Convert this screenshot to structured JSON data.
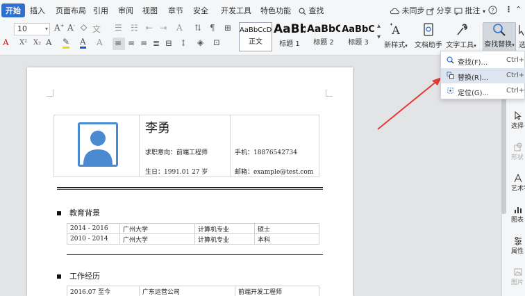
{
  "menu": {
    "tabs": [
      "开始",
      "插入",
      "页面布局",
      "引用",
      "审阅",
      "视图",
      "章节",
      "安全",
      "开发工具",
      "特色功能"
    ],
    "search_label": "查找",
    "sync": "未同步",
    "share": "分享",
    "comment": "批注"
  },
  "ribbon": {
    "font_size": "10",
    "styles": [
      {
        "preview": "AaBbCcDd",
        "name": "正文"
      },
      {
        "preview": "AaBb",
        "name": "标题 1"
      },
      {
        "preview": "AaBbC",
        "name": "标题 2"
      },
      {
        "preview": "AaBbC",
        "name": "标题 3"
      }
    ],
    "new_style": "新样式",
    "doc_helper": "文档助手",
    "text_tools": "文字工具",
    "find_replace": "查找替换",
    "select_cut": "选"
  },
  "dropdown": {
    "items": [
      {
        "label": "查找(F)...",
        "shortcut": "Ctrl+F"
      },
      {
        "label": "替换(R)...",
        "shortcut": "Ctrl+H"
      },
      {
        "label": "定位(G)...",
        "shortcut": "Ctrl+G"
      }
    ]
  },
  "resume": {
    "name": "李勇",
    "job_intent": "求职意向：前端工程师",
    "phone": "手机：18876542734",
    "birthday": "生日：1991.01 27 岁",
    "email": "邮箱：example@test.com",
    "edu_title": "教育背景",
    "education": [
      [
        "2014 - 2016",
        "广州大学",
        "计算机专业",
        "硕士"
      ],
      [
        "2010 - 2014",
        "广州大学",
        "计算机专业",
        "本科"
      ]
    ],
    "work_title": "工作经历",
    "work": [
      [
        "2016.07 至今",
        "广东运营公司",
        "前端开发工程师"
      ]
    ]
  },
  "sidepanel": {
    "items": [
      {
        "label": "选择",
        "enabled": true
      },
      {
        "label": "形状",
        "enabled": false
      },
      {
        "label": "艺术字",
        "enabled": true
      },
      {
        "label": "图表",
        "enabled": true
      },
      {
        "label": "属性",
        "enabled": true
      },
      {
        "label": "图片",
        "enabled": false
      }
    ]
  },
  "colors": {
    "accent": "#2f6fd0",
    "arrow": "#e53935",
    "avatar": "#4a8ad0",
    "highlight": "#dde6f0"
  }
}
